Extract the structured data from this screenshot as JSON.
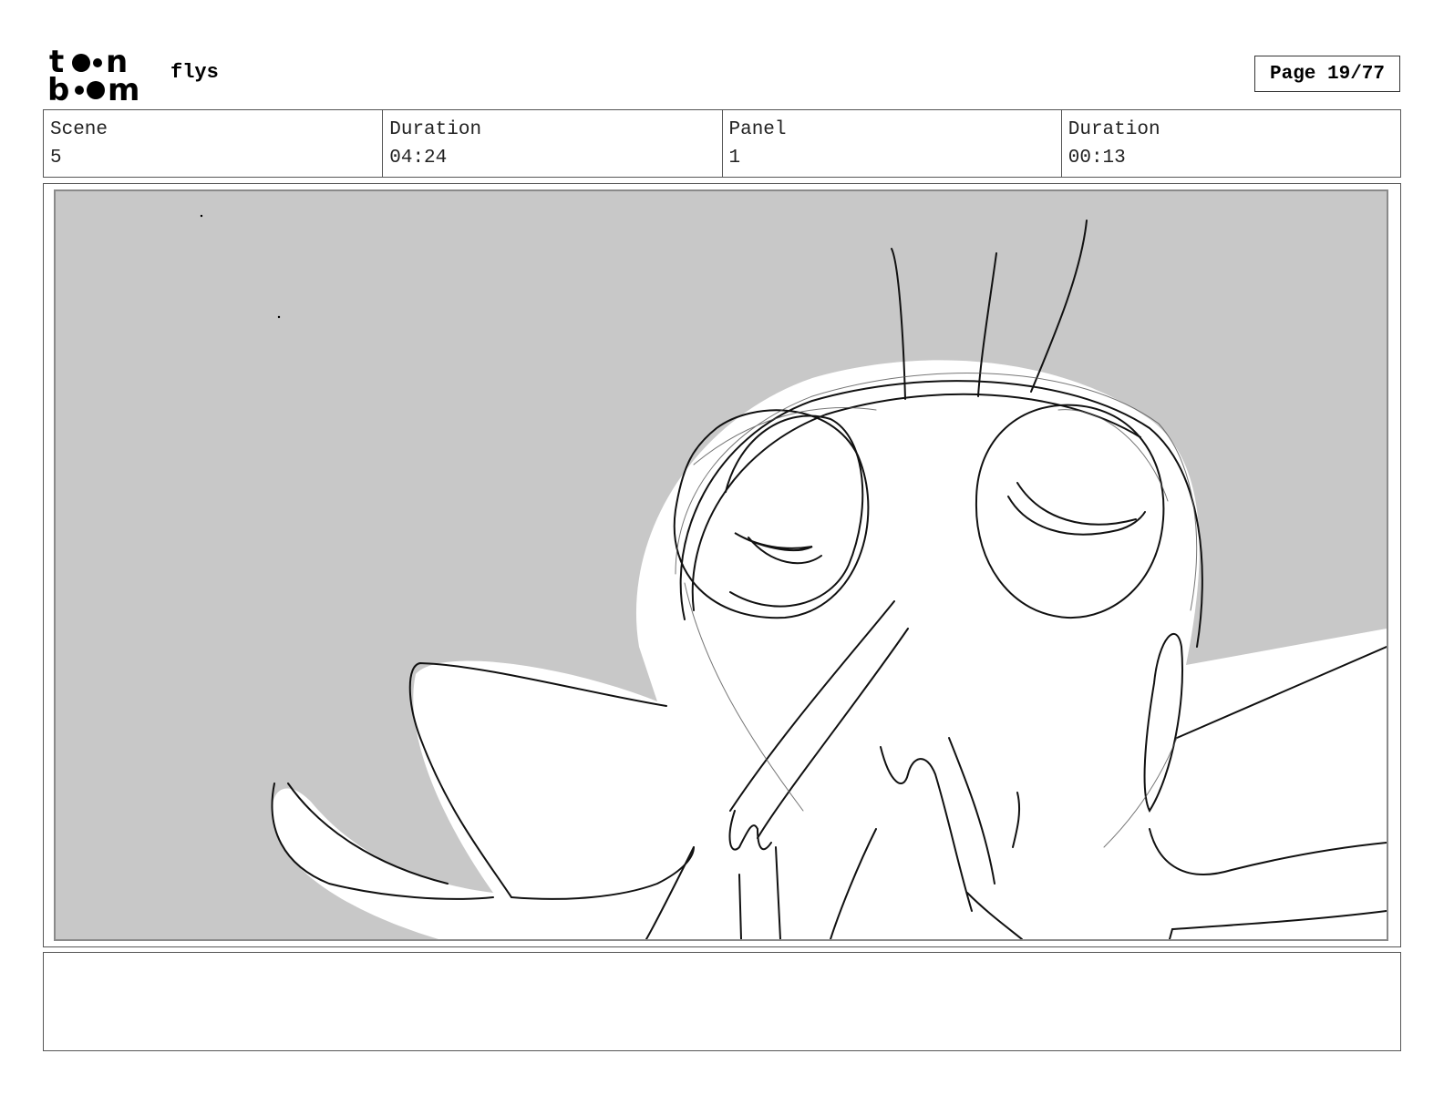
{
  "header": {
    "logo_icon": "toon-boom-logo",
    "project_title": "flys",
    "page_indicator": "Page 19/77"
  },
  "info": {
    "scene_label": "Scene",
    "scene_value": "5",
    "scene_duration_label": "Duration",
    "scene_duration_value": "04:24",
    "panel_label": "Panel",
    "panel_value": "1",
    "panel_duration_label": "Duration",
    "panel_duration_value": "00:13"
  },
  "panel": {
    "image_icon": "storyboard-sketch-fly-character",
    "background_color": "#c8c8c8"
  },
  "notes": {
    "text": ""
  }
}
